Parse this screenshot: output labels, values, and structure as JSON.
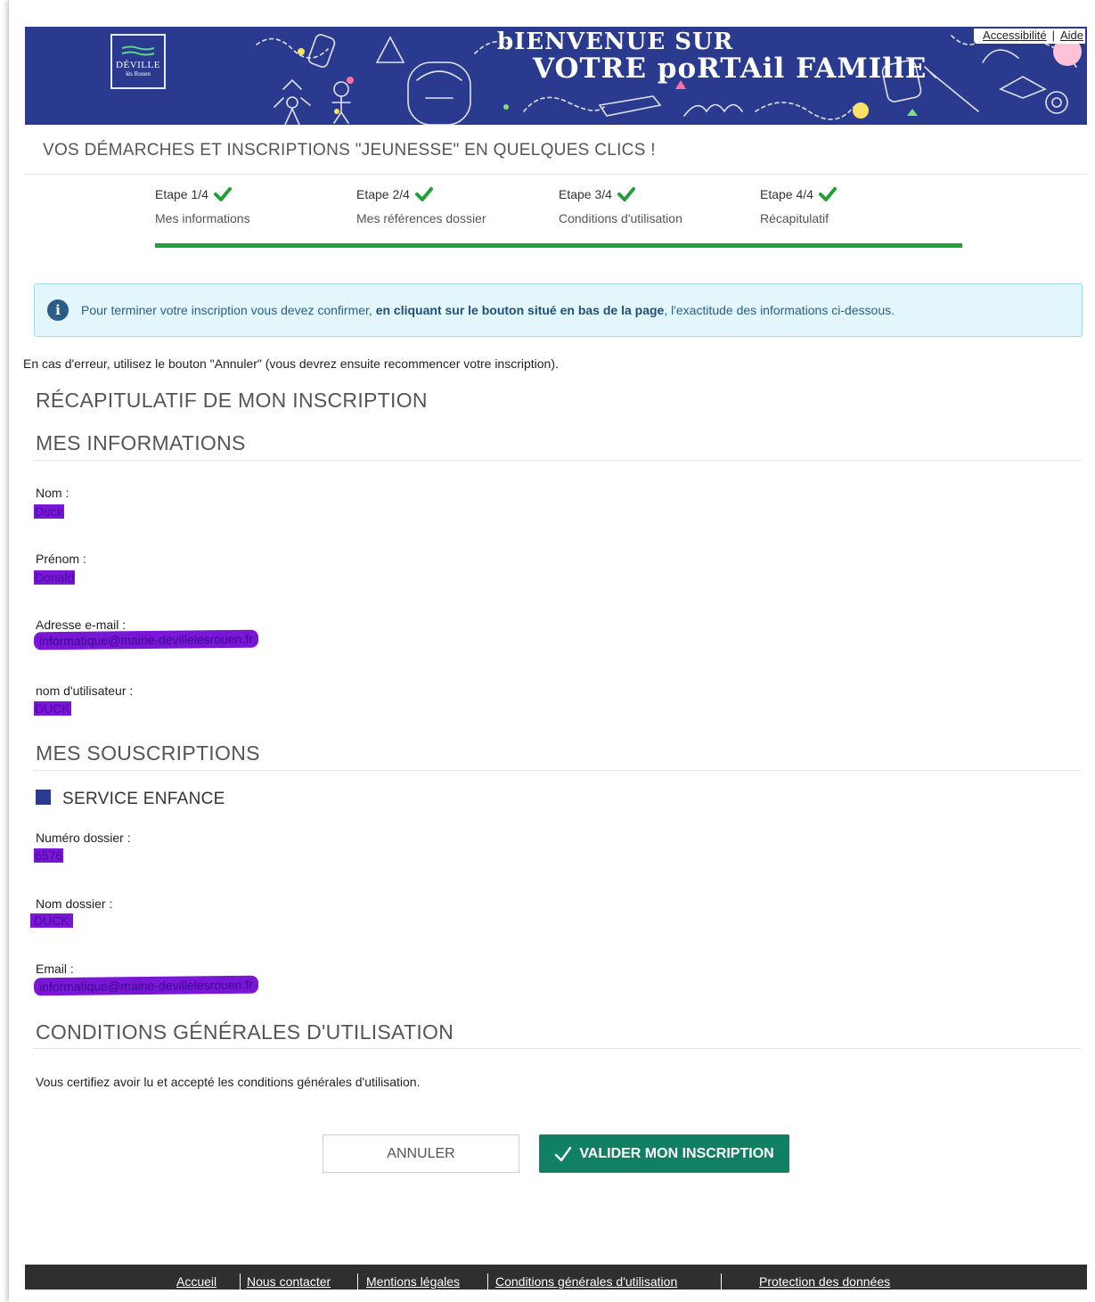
{
  "header": {
    "logo_line1": "DÉVILLE",
    "logo_line2": "lès Rouen",
    "banner_line1": "bIENVENUE SUR",
    "banner_line2": "VOTRE poRTAil FAMIllE",
    "link_accessibility": "Accessibilité",
    "link_separator": "|",
    "link_help": "Aide"
  },
  "subtitle": "VOS DÉMARCHES ET INSCRIPTIONS \"JEUNESSE\" EN QUELQUES CLICS !",
  "steps": [
    {
      "title": "Etape 1/4",
      "label": "Mes informations",
      "done": true
    },
    {
      "title": "Etape 2/4",
      "label": "Mes références dossier",
      "done": true
    },
    {
      "title": "Etape 3/4",
      "label": "Conditions d'utilisation",
      "done": true
    },
    {
      "title": "Etape 4/4",
      "label": "Récapitulatif",
      "done": true
    }
  ],
  "progress_fraction": 1.0,
  "info": {
    "text_before": "Pour terminer votre inscription vous devez confirmer, ",
    "text_bold": "en cliquant sur le bouton situé en bas de la page",
    "text_after": ", l'exactitude des informations ci-dessous."
  },
  "error_note": "En cas d'erreur, utilisez le bouton \"Annuler\" (vous devrez ensuite recommencer votre inscription).",
  "recap_title": "RÉCAPITULATIF DE MON INSCRIPTION",
  "my_info": {
    "heading": "MES INFORMATIONS",
    "nom_label": "Nom :",
    "nom_value": "Duck",
    "prenom_label": "Prénom :",
    "prenom_value": "Donald",
    "email_label": "Adresse e-mail :",
    "email_value": "informatique@mairie-devillelesrouen.fr",
    "username_label": "nom d'utilisateur :",
    "username_value": "DUCK"
  },
  "subscriptions": {
    "heading": "MES SOUSCRIPTIONS",
    "service": "SERVICE ENFANCE",
    "dossier_num_label": "Numéro dossier :",
    "dossier_num_value": "6576",
    "dossier_name_label": "Nom dossier :",
    "dossier_name_value": "DUCK",
    "email_label": "Email :",
    "email_value": "informatique@mairie-devillelesrouen.fr"
  },
  "cgu": {
    "heading": "CONDITIONS GÉNÉRALES D'UTILISATION",
    "text": "Vous certifiez avoir lu et accepté les conditions générales d'utilisation."
  },
  "buttons": {
    "cancel": "ANNULER",
    "validate": "VALIDER MON INSCRIPTION"
  },
  "footer": {
    "links": [
      "Accueil",
      "Nous contacter",
      "Mentions légales",
      "Conditions générales d'utilisation",
      "Protection des données"
    ]
  },
  "colors": {
    "banner_blue": "#2a3a8e",
    "success_green": "#21a038",
    "validate_button": "#118062",
    "info_background": "#e2f6fc",
    "redaction_purple": "#7a16d6",
    "footer_dark": "#2f2f2f"
  },
  "icons": {
    "step_status": "check-icon",
    "info": "info-circle-icon",
    "validate": "check-icon"
  }
}
